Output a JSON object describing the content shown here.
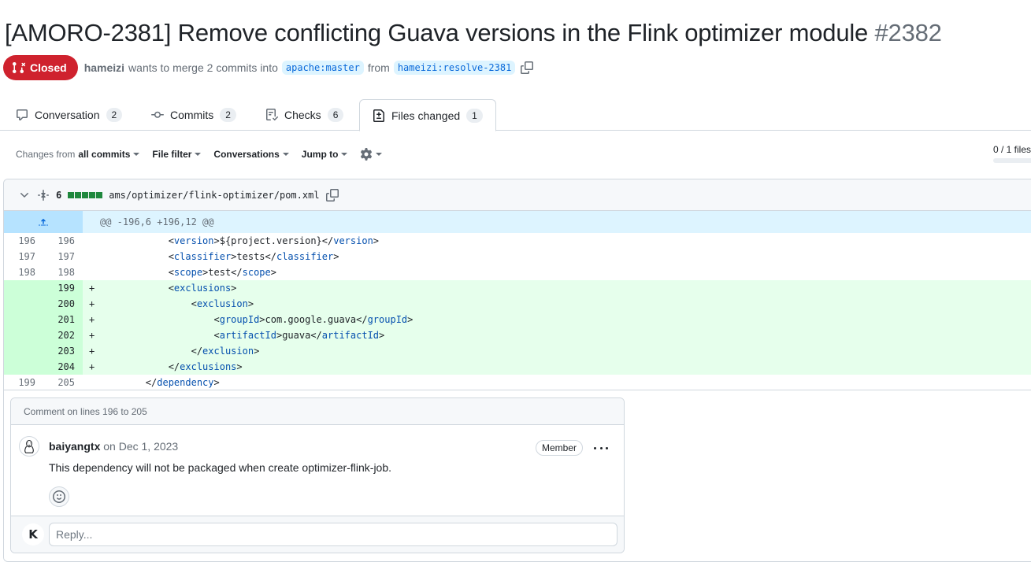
{
  "pr": {
    "title": "[AMORO-2381] Remove conflicting Guava versions in the Flink optimizer module",
    "number": "#2382",
    "state": "Closed",
    "author": "hameizi",
    "merge_text": "wants to merge 2 commits into",
    "base_branch": "apache:master",
    "from_text": "from",
    "head_branch": "hameizi:resolve-2381"
  },
  "tabs": [
    {
      "label": "Conversation",
      "count": "2",
      "icon": "comment-icon"
    },
    {
      "label": "Commits",
      "count": "2",
      "icon": "commit-icon"
    },
    {
      "label": "Checks",
      "count": "6",
      "icon": "checklist-icon"
    },
    {
      "label": "Files changed",
      "count": "1",
      "icon": "file-diff-icon"
    }
  ],
  "toolbar": {
    "changes_prefix": "Changes from",
    "changes_value": "all commits",
    "file_filter": "File filter",
    "conversations": "Conversations",
    "jump_to": "Jump to",
    "files_viewed": "0 / 1 files"
  },
  "file": {
    "changes": "6",
    "path": "ams/optimizer/flink-optimizer/pom.xml",
    "hunk": "@@ -196,6 +196,12 @@"
  },
  "diff_lines": [
    {
      "old": "196",
      "new": "196",
      "sign": "",
      "code": "            <version>${project.version}</version>",
      "type": "ctx"
    },
    {
      "old": "197",
      "new": "197",
      "sign": "",
      "code": "            <classifier>tests</classifier>",
      "type": "ctx"
    },
    {
      "old": "198",
      "new": "198",
      "sign": "",
      "code": "            <scope>test</scope>",
      "type": "ctx"
    },
    {
      "old": "",
      "new": "199",
      "sign": "+",
      "code": "            <exclusions>",
      "type": "add"
    },
    {
      "old": "",
      "new": "200",
      "sign": "+",
      "code": "                <exclusion>",
      "type": "add"
    },
    {
      "old": "",
      "new": "201",
      "sign": "+",
      "code": "                    <groupId>com.google.guava</groupId>",
      "type": "add"
    },
    {
      "old": "",
      "new": "202",
      "sign": "+",
      "code": "                    <artifactId>guava</artifactId>",
      "type": "add"
    },
    {
      "old": "",
      "new": "203",
      "sign": "+",
      "code": "                </exclusion>",
      "type": "add"
    },
    {
      "old": "",
      "new": "204",
      "sign": "+",
      "code": "            </exclusions>",
      "type": "add"
    },
    {
      "old": "199",
      "new": "205",
      "sign": "",
      "code": "        </dependency>",
      "type": "ctx"
    }
  ],
  "thread": {
    "header": "Comment on lines 196 to 205",
    "author": "baiyangtx",
    "date": "on Dec 1, 2023",
    "role": "Member",
    "body": "This dependency will not be packaged when create optimizer-flink-job.",
    "reply_placeholder": "Reply...",
    "reply_avatar_text": "K"
  },
  "colors": {
    "closed": "#cf222e",
    "added_bg": "#e6ffec",
    "added_num_bg": "#ccffd8",
    "hunk_bg": "#ddf4ff",
    "branch_text": "#0969da"
  }
}
